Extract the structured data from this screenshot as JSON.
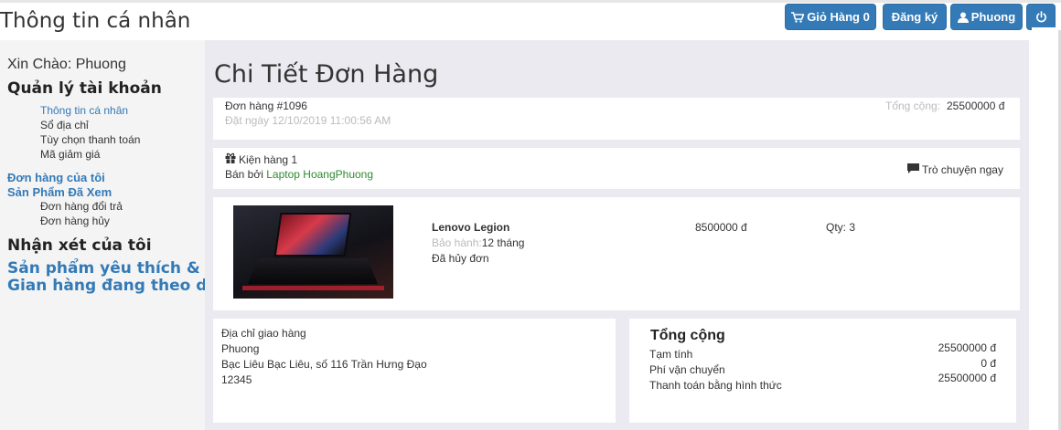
{
  "header": {
    "page_heading": "Thông tin cá nhân",
    "cart_button": "Giỏ Hàng 0",
    "register_button": "Đăng ký",
    "user_button": "Phuong"
  },
  "sidebar": {
    "greeting": "Xin Chào: Phuong",
    "account_heading": "Quản lý tài khoản",
    "account_items": [
      "Thông tin cá nhân",
      "Sổ địa chỉ",
      "Tùy chọn thanh toán",
      "Mã giảm giá"
    ],
    "orders_link": "Đơn hàng của tôi",
    "viewed_link": "Sản Phẩm Đã Xem",
    "order_items": [
      "Đơn hàng đổi trả",
      "Đơn hàng hủy"
    ],
    "reviews_heading": "Nhận xét của tôi",
    "favorites_link_line1": "Sản phẩm yêu thích &",
    "favorites_link_line2": "Gian hàng đang theo dõi"
  },
  "main": {
    "title": "Chi Tiết Đơn Hàng",
    "order": {
      "number": "Đơn hàng #1096",
      "date": "Đặt ngày 12/10/2019 11:00:56 AM",
      "total_label": "Tổng cộng:",
      "total_value": "25500000 đ"
    },
    "package": {
      "label": "Kiện hàng 1",
      "sold_by_label": "Bán bởi",
      "seller": "Laptop HoangPhuong",
      "chat_label": "Trò chuyện ngay"
    },
    "item": {
      "name": "Lenovo Legion",
      "warranty_label": "Bảo hành:",
      "warranty_value": "12 tháng",
      "status": "Đã hủy đơn",
      "price": "8500000 đ",
      "qty": "Qty: 3"
    },
    "shipping": {
      "title": "Địa chỉ giao hàng",
      "name": "Phuong",
      "address": "Bạc Liêu Bạc Liêu, số 116 Trần Hưng Đạo",
      "postal": "12345"
    },
    "summary": {
      "title": "Tổng cộng",
      "subtotal_label": "Tạm tính",
      "subtotal_value": "25500000 đ",
      "shipping_label": "Phí vận chuyển",
      "shipping_value": "0 đ",
      "payment_label": "Thanh toán bằng hình thức",
      "payment_value": "25500000 đ"
    }
  },
  "colors": {
    "primary": "#337ab7",
    "seller_green": "#2e8b2e",
    "muted": "#bbbbbb",
    "main_bg": "#eaeaf0"
  }
}
